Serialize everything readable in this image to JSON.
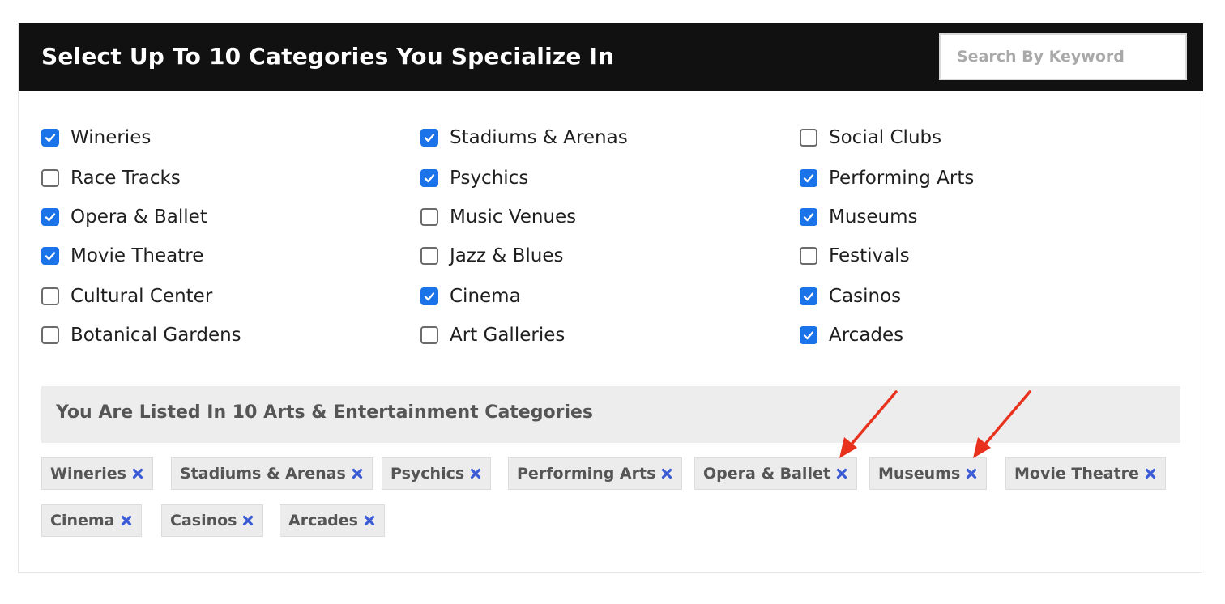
{
  "header": {
    "title": "Select Up To 10 Categories You Specialize In",
    "search_placeholder": "Search By Keyword"
  },
  "categories": {
    "col1": [
      {
        "label": "Wineries",
        "checked": true
      },
      {
        "label": "Race Tracks",
        "checked": false
      },
      {
        "label": "Opera & Ballet",
        "checked": true
      },
      {
        "label": "Movie Theatre",
        "checked": true
      },
      {
        "label": "Cultural Center",
        "checked": false
      },
      {
        "label": "Botanical Gardens",
        "checked": false
      }
    ],
    "col2": [
      {
        "label": "Stadiums & Arenas",
        "checked": true
      },
      {
        "label": "Psychics",
        "checked": true
      },
      {
        "label": "Music Venues",
        "checked": false
      },
      {
        "label": "Jazz & Blues",
        "checked": false
      },
      {
        "label": "Cinema",
        "checked": true
      },
      {
        "label": "Art Galleries",
        "checked": false
      }
    ],
    "col3": [
      {
        "label": "Social Clubs",
        "checked": false
      },
      {
        "label": "Performing Arts",
        "checked": true
      },
      {
        "label": "Museums",
        "checked": true
      },
      {
        "label": "Festivals",
        "checked": false
      },
      {
        "label": "Casinos",
        "checked": true
      },
      {
        "label": "Arcades",
        "checked": true
      }
    ]
  },
  "summary": {
    "text": "You Are Listed In 10 Arts & Entertainment Categories"
  },
  "selected_tags": [
    "Wineries",
    "Stadiums & Arenas",
    "Psychics",
    "Performing Arts",
    "Opera & Ballet",
    "Museums",
    "Movie Theatre",
    "Cinema",
    "Casinos",
    "Arcades"
  ],
  "colors": {
    "header_bg": "#111111",
    "checkbox_accent": "#1a73e8",
    "remove_icon": "#3b5bd6",
    "annotation_arrow": "#e8321e"
  },
  "icons": {
    "checkbox_mark": "checkmark-icon",
    "tag_remove": "close-x-icon",
    "annotation": "red-arrow-icon"
  }
}
